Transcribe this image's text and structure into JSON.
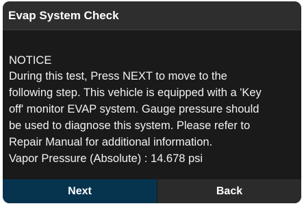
{
  "dialog": {
    "title": "Evap System Check",
    "message_lines": [
      "NOTICE",
      "During this test, Press NEXT to move to the",
      "following step. This vehicle is equipped with a 'Key",
      "off' monitor EVAP system. Gauge pressure should",
      "be used to diagnose this system. Please refer to",
      "Repair Manual for additional information.",
      "Vapor Pressure (Absolute) : 14.678 psi"
    ]
  },
  "buttons": {
    "next_label": "Next",
    "back_label": "Back"
  },
  "colors": {
    "background": "#1a1a1a",
    "title_bar": "#2e2e2e",
    "next_button": "#06344f",
    "back_button": "#2b2b2b",
    "text": "#ffffff"
  }
}
